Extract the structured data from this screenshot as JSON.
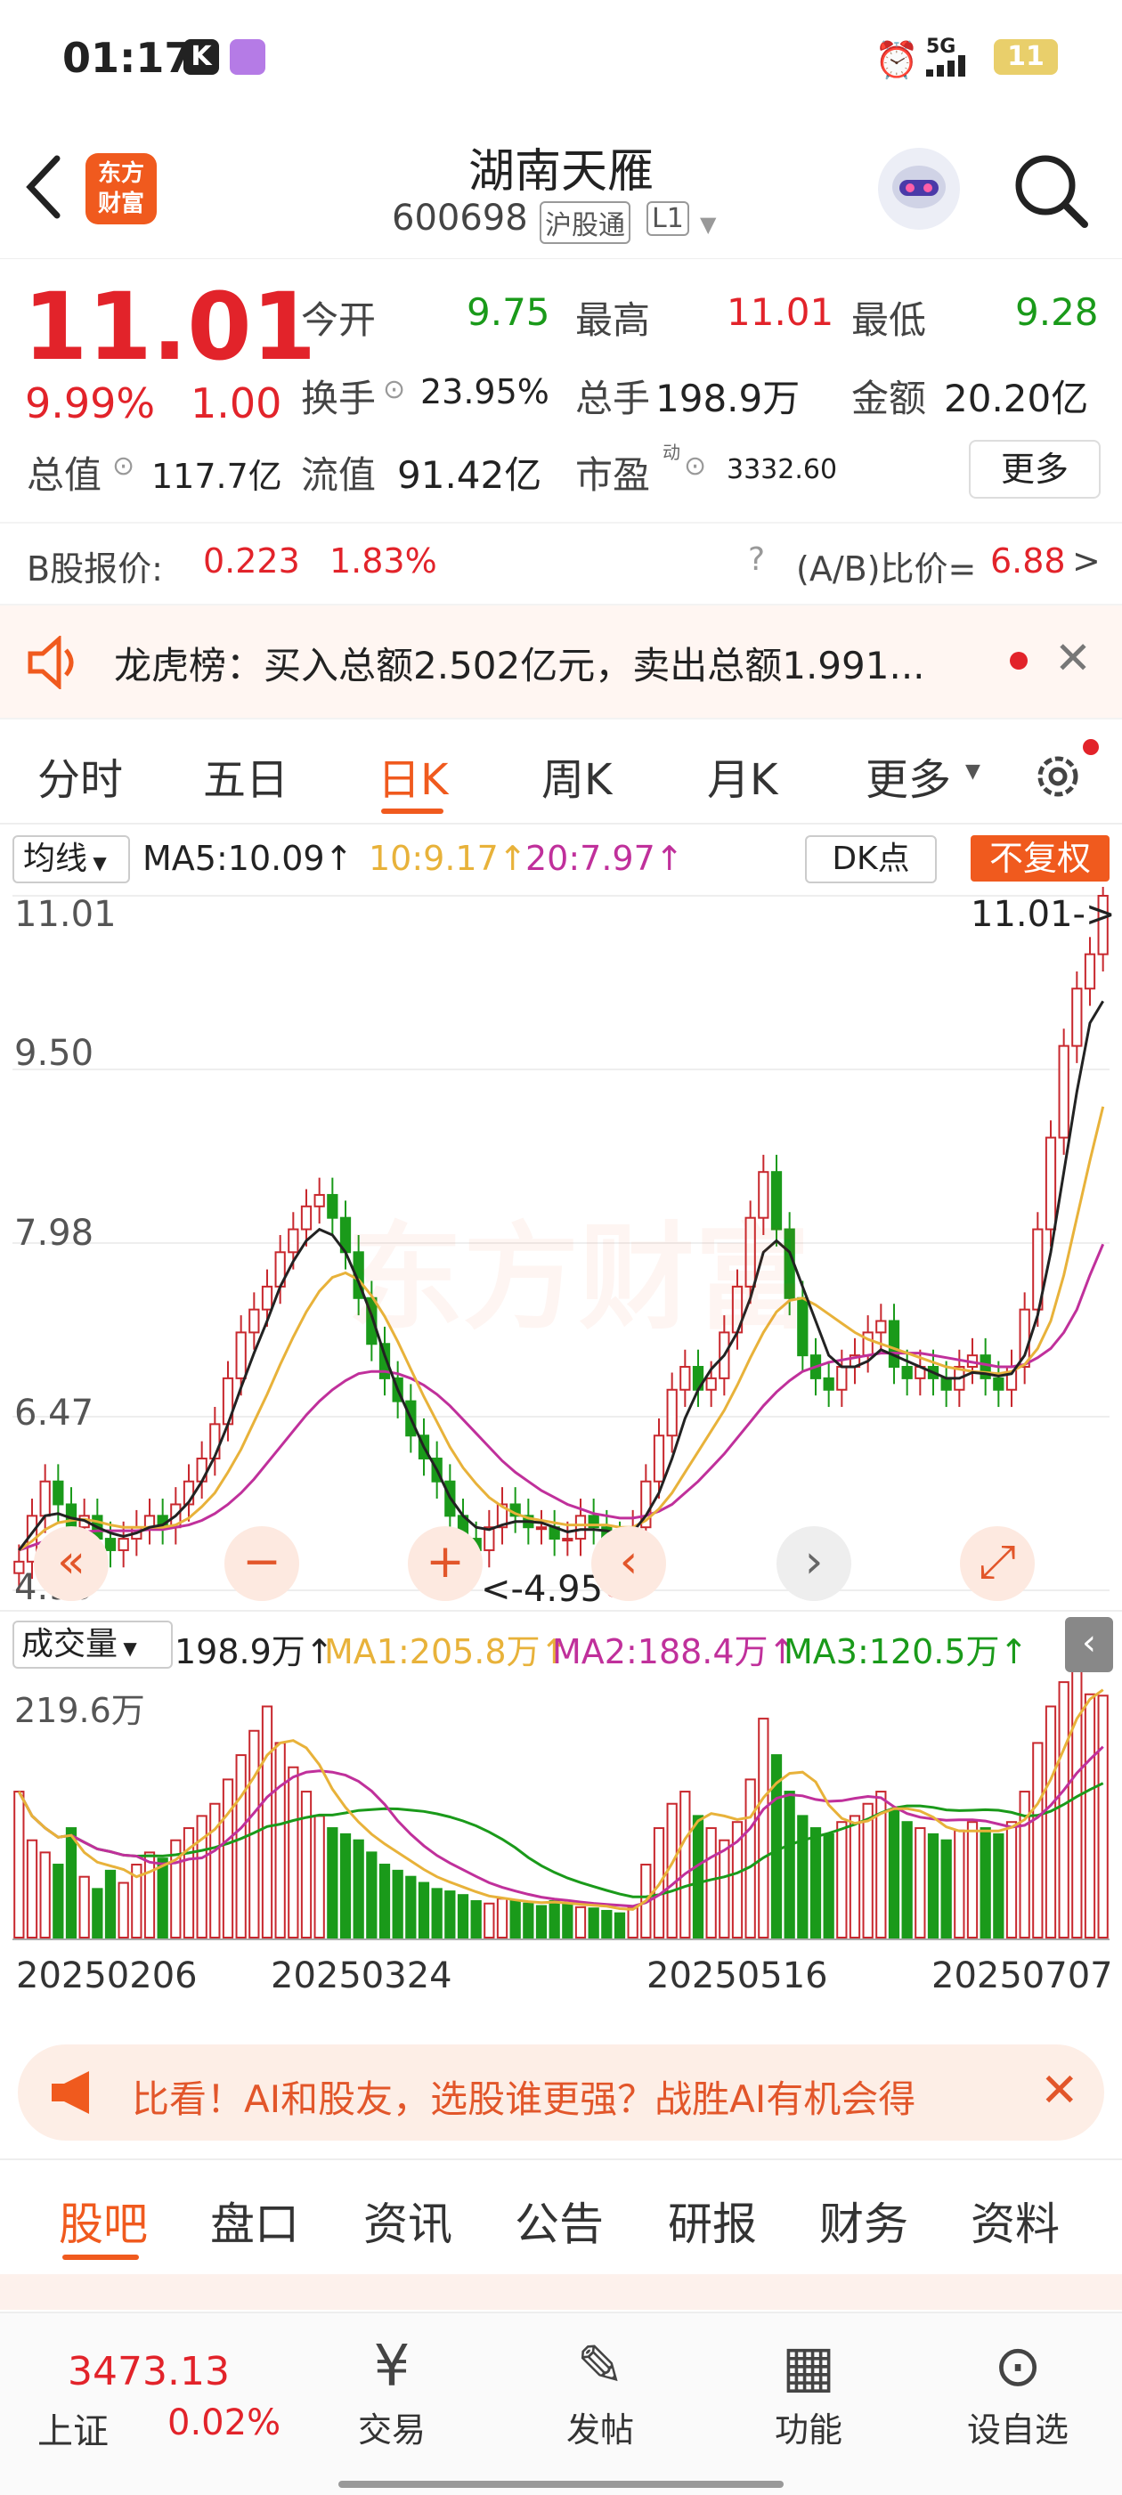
{
  "status": {
    "time": "01:17",
    "network": "5G",
    "battery": "11"
  },
  "header": {
    "title": "湖南天雁",
    "code": "600698",
    "tag1": "沪股通",
    "tag2": "L1",
    "logo": "东方\n财富"
  },
  "quote": {
    "price": "11.01",
    "pct": "9.99%",
    "change": "1.00",
    "open_label": "今开",
    "open": "9.75",
    "high_label": "最高",
    "high": "11.01",
    "low_label": "最低",
    "low": "9.28",
    "turnover_label": "换手",
    "turnover": "23.95%",
    "volume_label": "总手",
    "volume": "198.9万",
    "amount_label": "金额",
    "amount": "20.20亿",
    "mktcap_label": "总值",
    "mktcap": "117.7亿",
    "float_label": "流值",
    "float": "91.42亿",
    "pe_label": "市盈",
    "pe_sup": "动",
    "pe": "3332.60",
    "more": "更多"
  },
  "bshare": {
    "label": "B股报价:",
    "price": "0.223",
    "pct": "1.83%",
    "ratio_label": "(A/B)比价=",
    "ratio": "6.88",
    "arrow": ">"
  },
  "notice": {
    "text": "龙虎榜：买入总额2.502亿元，卖出总额1.991..."
  },
  "period_tabs": [
    "分时",
    "五日",
    "日K",
    "周K",
    "月K",
    "更多"
  ],
  "active_tab": "日K",
  "ma_bar": {
    "select": "均线",
    "ma5": "MA5:10.09↑",
    "ma10": "10:9.17↑",
    "ma20": "20:7.97↑",
    "dk": "DK点",
    "fq": "不复权"
  },
  "chart_data": {
    "type": "candlestick",
    "y_ticks": [
      "11.01",
      "9.50",
      "7.98",
      "6.47",
      "4.95"
    ],
    "ylim": [
      4.95,
      11.01
    ],
    "last_label": "11.01->",
    "low_label": "<-4.95",
    "watermark": "东方财富",
    "x_ticks": [
      "20250206",
      "20250324",
      "20250516",
      "20250707"
    ],
    "close": [
      5.2,
      5.6,
      5.9,
      5.7,
      5.5,
      5.6,
      5.4,
      5.3,
      5.4,
      5.5,
      5.6,
      5.5,
      5.7,
      5.9,
      6.1,
      6.4,
      6.8,
      7.2,
      7.4,
      7.6,
      7.9,
      8.1,
      8.3,
      8.4,
      8.2,
      7.9,
      7.5,
      7.1,
      6.8,
      6.6,
      6.3,
      6.1,
      5.9,
      5.6,
      5.4,
      5.3,
      5.5,
      5.7,
      5.6,
      5.5,
      5.5,
      5.4,
      5.4,
      5.6,
      5.5,
      5.4,
      5.3,
      5.5,
      5.9,
      6.3,
      6.7,
      6.9,
      6.7,
      6.8,
      7.2,
      7.6,
      8.2,
      8.6,
      8.1,
      7.5,
      7.0,
      6.8,
      6.7,
      6.9,
      7.0,
      7.2,
      7.3,
      6.9,
      6.8,
      6.9,
      6.8,
      6.7,
      6.9,
      7.0,
      6.8,
      6.7,
      6.9,
      7.4,
      8.1,
      8.9,
      9.7,
      10.2,
      10.5,
      11.01
    ],
    "ma5": [
      5.3,
      5.45,
      5.6,
      5.62,
      5.58,
      5.56,
      5.5,
      5.45,
      5.42,
      5.45,
      5.5,
      5.52,
      5.6,
      5.72,
      5.9,
      6.12,
      6.4,
      6.72,
      7.02,
      7.3,
      7.6,
      7.82,
      8.0,
      8.1,
      8.05,
      7.9,
      7.64,
      7.35,
      7.0,
      6.7,
      6.45,
      6.2,
      6.0,
      5.76,
      5.6,
      5.5,
      5.48,
      5.52,
      5.55,
      5.55,
      5.54,
      5.5,
      5.46,
      5.48,
      5.48,
      5.47,
      5.44,
      5.46,
      5.6,
      5.8,
      6.1,
      6.45,
      6.7,
      6.88,
      7.0,
      7.2,
      7.5,
      7.9,
      8.0,
      7.9,
      7.6,
      7.3,
      7.0,
      6.9,
      6.9,
      6.95,
      7.05,
      7.0,
      6.95,
      6.9,
      6.85,
      6.8,
      6.8,
      6.85,
      6.84,
      6.82,
      6.84,
      7.0,
      7.35,
      7.9,
      8.6,
      9.3,
      9.9,
      10.09
    ],
    "ma10": [
      5.3,
      5.38,
      5.48,
      5.54,
      5.56,
      5.57,
      5.55,
      5.52,
      5.5,
      5.5,
      5.5,
      5.5,
      5.52,
      5.58,
      5.68,
      5.8,
      5.98,
      6.18,
      6.42,
      6.66,
      6.92,
      7.16,
      7.38,
      7.56,
      7.68,
      7.72,
      7.66,
      7.52,
      7.34,
      7.12,
      6.88,
      6.64,
      6.42,
      6.2,
      6.02,
      5.88,
      5.76,
      5.68,
      5.62,
      5.58,
      5.56,
      5.54,
      5.52,
      5.52,
      5.52,
      5.52,
      5.5,
      5.5,
      5.56,
      5.66,
      5.8,
      5.98,
      6.16,
      6.34,
      6.52,
      6.74,
      6.98,
      7.2,
      7.38,
      7.48,
      7.5,
      7.44,
      7.36,
      7.28,
      7.2,
      7.14,
      7.1,
      7.06,
      7.02,
      6.98,
      6.94,
      6.9,
      6.88,
      6.86,
      6.85,
      6.84,
      6.86,
      6.92,
      7.06,
      7.3,
      7.7,
      8.2,
      8.7,
      9.17
    ],
    "ma20": [
      5.3,
      5.34,
      5.38,
      5.42,
      5.44,
      5.46,
      5.47,
      5.47,
      5.47,
      5.47,
      5.48,
      5.48,
      5.5,
      5.52,
      5.56,
      5.62,
      5.7,
      5.8,
      5.92,
      6.06,
      6.2,
      6.34,
      6.48,
      6.6,
      6.7,
      6.78,
      6.84,
      6.86,
      6.86,
      6.84,
      6.8,
      6.74,
      6.66,
      6.56,
      6.44,
      6.32,
      6.2,
      6.08,
      5.98,
      5.9,
      5.82,
      5.76,
      5.7,
      5.66,
      5.62,
      5.6,
      5.58,
      5.58,
      5.6,
      5.64,
      5.7,
      5.8,
      5.9,
      6.02,
      6.14,
      6.28,
      6.42,
      6.56,
      6.68,
      6.78,
      6.86,
      6.9,
      6.94,
      6.96,
      6.98,
      7.0,
      7.02,
      7.02,
      7.02,
      7.02,
      7.0,
      6.98,
      6.96,
      6.94,
      6.92,
      6.9,
      6.9,
      6.92,
      6.98,
      7.06,
      7.2,
      7.4,
      7.7,
      7.97
    ],
    "volume_title": "成交量",
    "volume_max_label": "219.6万",
    "volume": [
      120,
      80,
      70,
      60,
      90,
      50,
      40,
      55,
      45,
      60,
      70,
      65,
      80,
      90,
      100,
      110,
      130,
      150,
      170,
      190,
      160,
      140,
      120,
      100,
      90,
      85,
      80,
      70,
      60,
      55,
      50,
      45,
      40,
      38,
      35,
      30,
      28,
      32,
      30,
      28,
      26,
      30,
      28,
      25,
      24,
      22,
      20,
      25,
      60,
      90,
      110,
      120,
      100,
      90,
      80,
      95,
      130,
      180,
      150,
      120,
      100,
      90,
      85,
      95,
      100,
      110,
      120,
      105,
      95,
      90,
      85,
      80,
      88,
      95,
      90,
      85,
      95,
      120,
      160,
      190,
      210,
      219.6,
      200,
      198.9
    ],
    "vol_up": [
      1,
      1,
      1,
      0,
      0,
      1,
      0,
      0,
      1,
      1,
      1,
      0,
      1,
      1,
      1,
      1,
      1,
      1,
      1,
      1,
      1,
      1,
      1,
      1,
      0,
      0,
      0,
      0,
      0,
      0,
      0,
      0,
      0,
      0,
      0,
      0,
      1,
      1,
      0,
      0,
      0,
      0,
      0,
      1,
      0,
      0,
      0,
      1,
      1,
      1,
      1,
      1,
      0,
      1,
      1,
      1,
      1,
      1,
      0,
      0,
      0,
      0,
      0,
      1,
      1,
      1,
      1,
      0,
      0,
      1,
      0,
      0,
      1,
      1,
      0,
      0,
      1,
      1,
      1,
      1,
      1,
      1,
      1,
      1
    ],
    "volume_bar": {
      "select": "成交量",
      "v": "198.9万↑",
      "ma1": "MA1:205.8万↑",
      "ma2": "MA2:188.4万↑",
      "ma3": "MA3:120.5万↑"
    }
  },
  "promo": {
    "text": "比看！AI和股友，选股谁更强？战胜AI有机会得"
  },
  "bottom_tabs": [
    "股吧",
    "盘口",
    "资讯",
    "公告",
    "研报",
    "财务",
    "资料"
  ],
  "index": {
    "value": "3473.13",
    "name": "上证",
    "pct": "0.02%"
  },
  "bottom_nav": [
    "交易",
    "发帖",
    "功能",
    "设自选"
  ]
}
